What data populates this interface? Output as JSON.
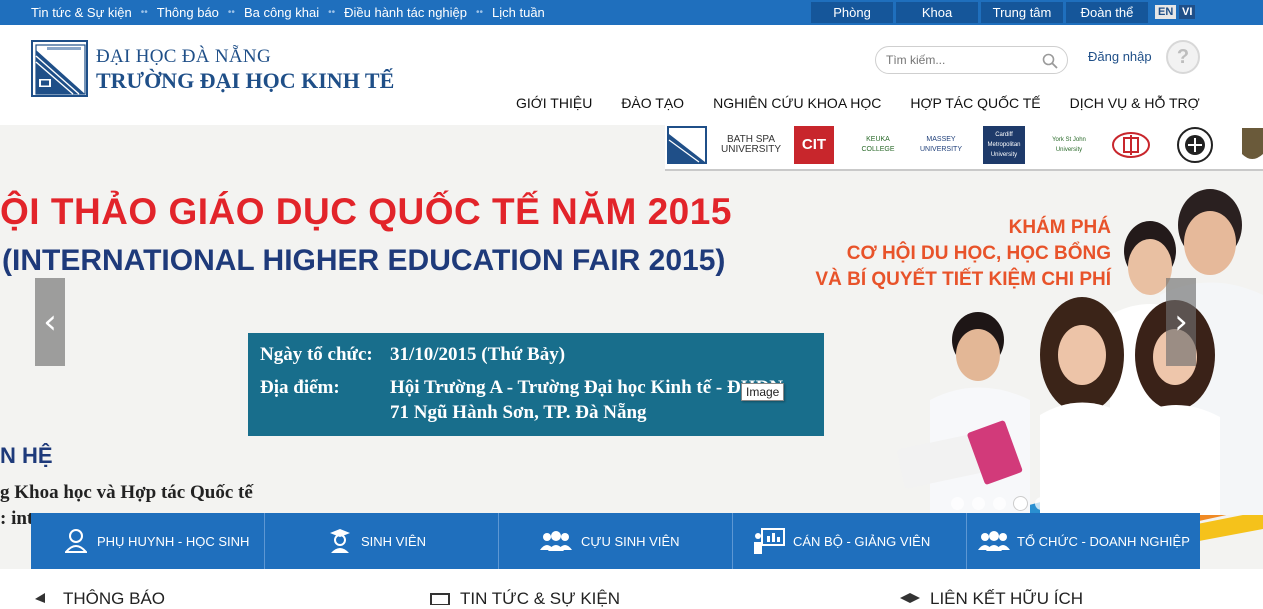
{
  "topbar": {
    "links": [
      "Tin tức & Sự kiện",
      "Thông báo",
      "Ba công khai",
      "Điều hành tác nghiệp",
      "Lịch tuần"
    ],
    "buttons": [
      "Phòng",
      "Khoa",
      "Trung tâm",
      "Đoàn thể"
    ],
    "lang": [
      "EN",
      "VI"
    ]
  },
  "header": {
    "name_line1": "ĐẠI HỌC ĐÀ NẴNG",
    "name_line2": "TRƯỜNG ĐẠI HỌC KINH TẾ",
    "search_placeholder": "Tìm kiếm...",
    "login_label": "Đăng nhập",
    "nav": [
      "GIỚI THIỆU",
      "ĐÀO TẠO",
      "NGHIÊN CỨU KHOA HỌC",
      "HỢP TÁC QUỐC TẾ",
      "DỊCH VỤ & HỖ TRỢ"
    ]
  },
  "banner": {
    "title_line1": "ỘI THẢO GIÁO DỤC QUỐC TẾ NĂM 2015",
    "title_line2": "(INTERNATIONAL HIGHER EDUCATION FAIR 2015)",
    "promo_line1": "KHÁM PHÁ",
    "promo_line2": "CƠ HỘI DU HỌC, HỌC BỔNG",
    "promo_line3": "VÀ BÍ QUYẾT TIẾT KIỆM CHI PHÍ",
    "date_label": "Ngày tổ chức:",
    "date_value": "31/10/2015 (Thứ Bảy)",
    "place_label": "Địa điểm:",
    "place_value_line1": "Hội Trường A - Trường Đại học Kinh tế - ĐHĐN",
    "place_value_line2": "71 Ngũ Hành Sơn, TP. Đà Nẵng",
    "contact_heading": "N HỆ",
    "contact_line1": "g Khoa học và Hợp tác Quốc tế",
    "contact_line2": ": int",
    "tooltip": "Image",
    "prev_arrow": "‹",
    "next_arrow": "›",
    "partners": [
      "BATH SPA UNIVERSITY",
      "CIT",
      "KEUKA COLLEGE",
      "MASSEY UNIVERSITY",
      "Cardiff Metropolitan University",
      "York St John University"
    ],
    "slide_count": 11,
    "active_slide": 4
  },
  "quicklinks": [
    "PHỤ HUYNH - HỌC SINH",
    "SINH VIÊN",
    "CỰU SINH VIÊN",
    "CÁN BỘ - GIẢNG VIÊN",
    "TỔ CHỨC - DOANH NGHIỆP"
  ],
  "sections": [
    "THÔNG BÁO",
    "TIN TỨC & SỰ KIỆN",
    "LIÊN KẾT HỮU ÍCH"
  ]
}
